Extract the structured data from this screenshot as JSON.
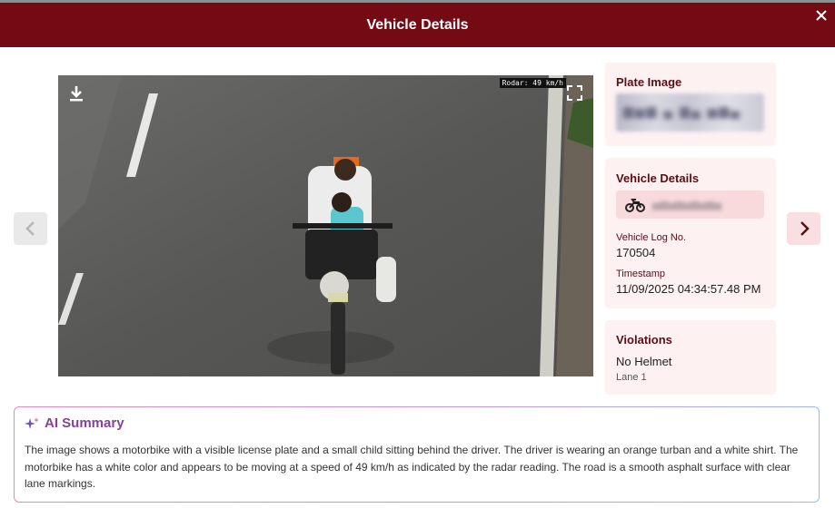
{
  "header": {
    "title": "Vehicle Details",
    "close_icon": "close-icon"
  },
  "photo": {
    "radar_overlay": "Rodar: 49 km/h",
    "download_icon": "download-icon",
    "fullscreen_icon": "fullscreen-icon"
  },
  "nav": {
    "prev_icon": "chevron-left-icon",
    "next_icon": "chevron-right-icon"
  },
  "plate_card": {
    "title": "Plate Image"
  },
  "vehicle_card": {
    "title": "Vehicle Details",
    "vehicle_icon": "motorbike-icon",
    "log_label": "Vehicle Log No.",
    "log_value": "170504",
    "timestamp_label": "Timestamp",
    "timestamp_value": "11/09/2025 04:34:57.48 PM"
  },
  "violations_card": {
    "title": "Violations",
    "violation": "No Helmet",
    "lane": "Lane 1"
  },
  "ai_summary": {
    "title": "AI Summary",
    "icon": "sparkle-icon",
    "text": "The image shows a motorbike with a visible license plate and a small child sitting behind the driver. The driver is wearing an orange turban and a white shirt. The motorbike has a white color and appears to be moving at a speed of 49 km/h as indicated by the radar reading. The road is a smooth asphalt surface with clear lane markings."
  },
  "colors": {
    "header": "#740a14",
    "card_bg": "#fdf1f2",
    "accent_text": "#5a0e14",
    "ai_title": "#8a3f9f"
  }
}
